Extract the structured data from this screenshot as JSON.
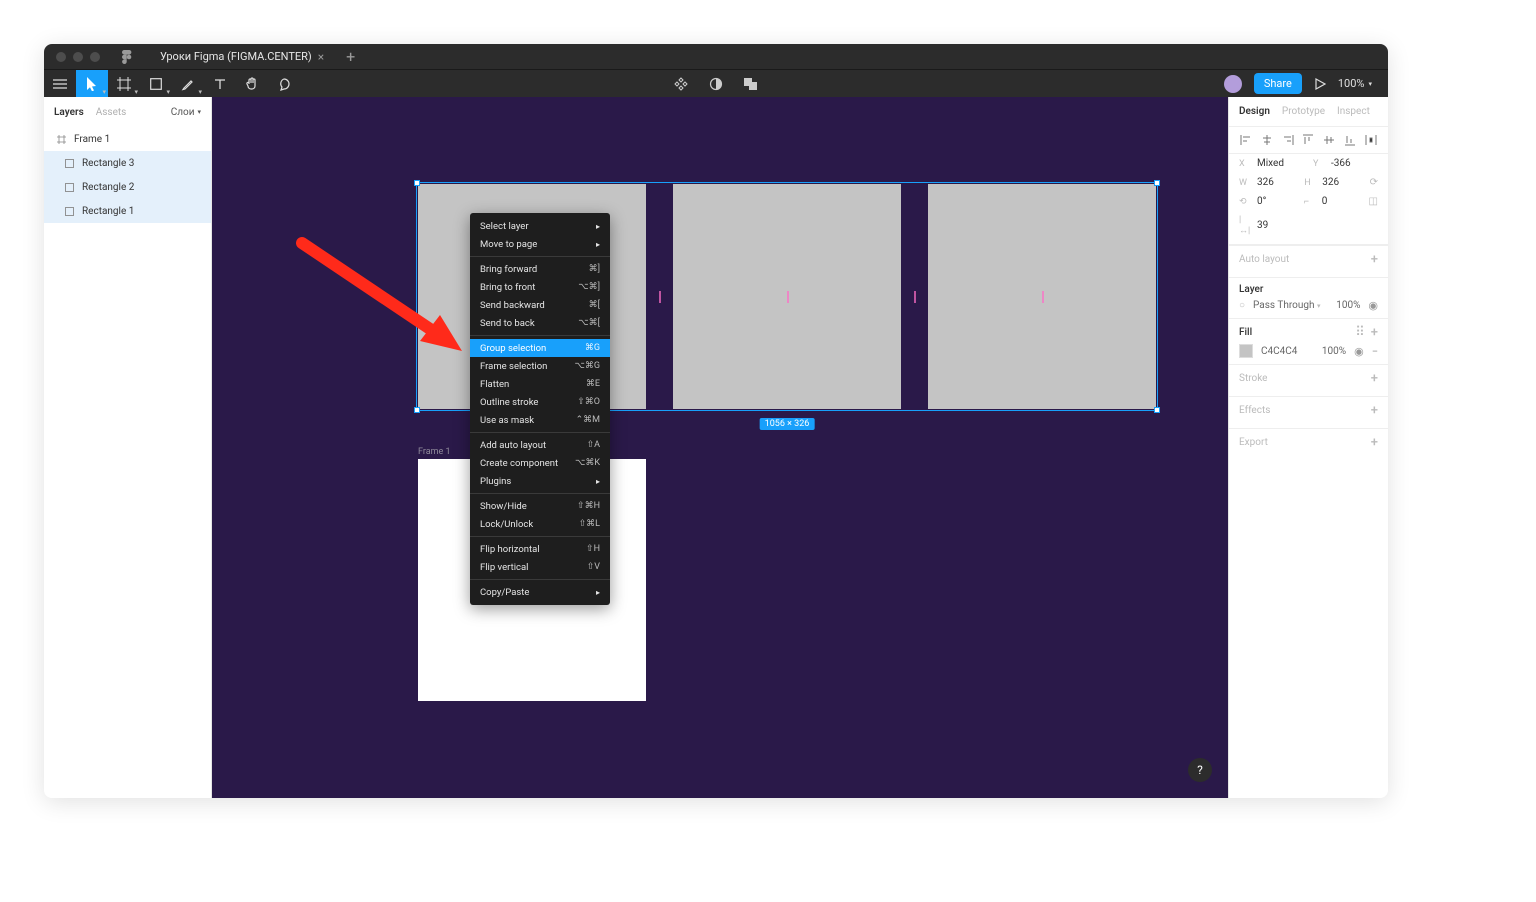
{
  "tab": {
    "title": "Уроки Figma (FIGMA.CENTER)"
  },
  "toolbar": {
    "share": "Share",
    "zoom": "100%"
  },
  "leftPanel": {
    "tabs": {
      "layers": "Layers",
      "assets": "Assets",
      "page": "Слои"
    },
    "layers": [
      {
        "name": "Frame 1",
        "type": "frame",
        "selected": false
      },
      {
        "name": "Rectangle 3",
        "type": "rect",
        "selected": true
      },
      {
        "name": "Rectangle 2",
        "type": "rect",
        "selected": true
      },
      {
        "name": "Rectangle 1",
        "type": "rect",
        "selected": true
      }
    ]
  },
  "canvas": {
    "selectionSize": "1056 × 326",
    "frameLabel": "Frame 1"
  },
  "contextMenu": {
    "g1": [
      {
        "label": "Select layer",
        "sub": true
      },
      {
        "label": "Move to page",
        "sub": true
      }
    ],
    "g2": [
      {
        "label": "Bring forward",
        "sc": "⌘]"
      },
      {
        "label": "Bring to front",
        "sc": "⌥⌘]"
      },
      {
        "label": "Send backward",
        "sc": "⌘["
      },
      {
        "label": "Send to back",
        "sc": "⌥⌘["
      }
    ],
    "g3": [
      {
        "label": "Group selection",
        "sc": "⌘G",
        "hl": true
      },
      {
        "label": "Frame selection",
        "sc": "⌥⌘G"
      },
      {
        "label": "Flatten",
        "sc": "⌘E"
      },
      {
        "label": "Outline stroke",
        "sc": "⇧⌘O"
      },
      {
        "label": "Use as mask",
        "sc": "⌃⌘M"
      }
    ],
    "g4": [
      {
        "label": "Add auto layout",
        "sc": "⇧A"
      },
      {
        "label": "Create component",
        "sc": "⌥⌘K"
      },
      {
        "label": "Plugins",
        "sub": true
      }
    ],
    "g5": [
      {
        "label": "Show/Hide",
        "sc": "⇧⌘H"
      },
      {
        "label": "Lock/Unlock",
        "sc": "⇧⌘L"
      }
    ],
    "g6": [
      {
        "label": "Flip horizontal",
        "sc": "⇧H"
      },
      {
        "label": "Flip vertical",
        "sc": "⇧V"
      }
    ],
    "g7": [
      {
        "label": "Copy/Paste",
        "sub": true
      }
    ]
  },
  "rightPanel": {
    "tabs": {
      "design": "Design",
      "prototype": "Prototype",
      "inspect": "Inspect"
    },
    "props": {
      "xLabel": "X",
      "x": "Mixed",
      "yLabel": "Y",
      "y": "-366",
      "wLabel": "W",
      "w": "326",
      "hLabel": "H",
      "h": "326",
      "rotLabel": "⟲",
      "rot": "0°",
      "radLabel": "⌐",
      "rad": "0",
      "gap": "39"
    },
    "autoLayout": "Auto layout",
    "layer": {
      "title": "Layer",
      "mode": "Pass Through",
      "opacity": "100%"
    },
    "fill": {
      "title": "Fill",
      "hex": "C4C4C4",
      "opacity": "100%"
    },
    "stroke": "Stroke",
    "effects": "Effects",
    "export": "Export"
  }
}
